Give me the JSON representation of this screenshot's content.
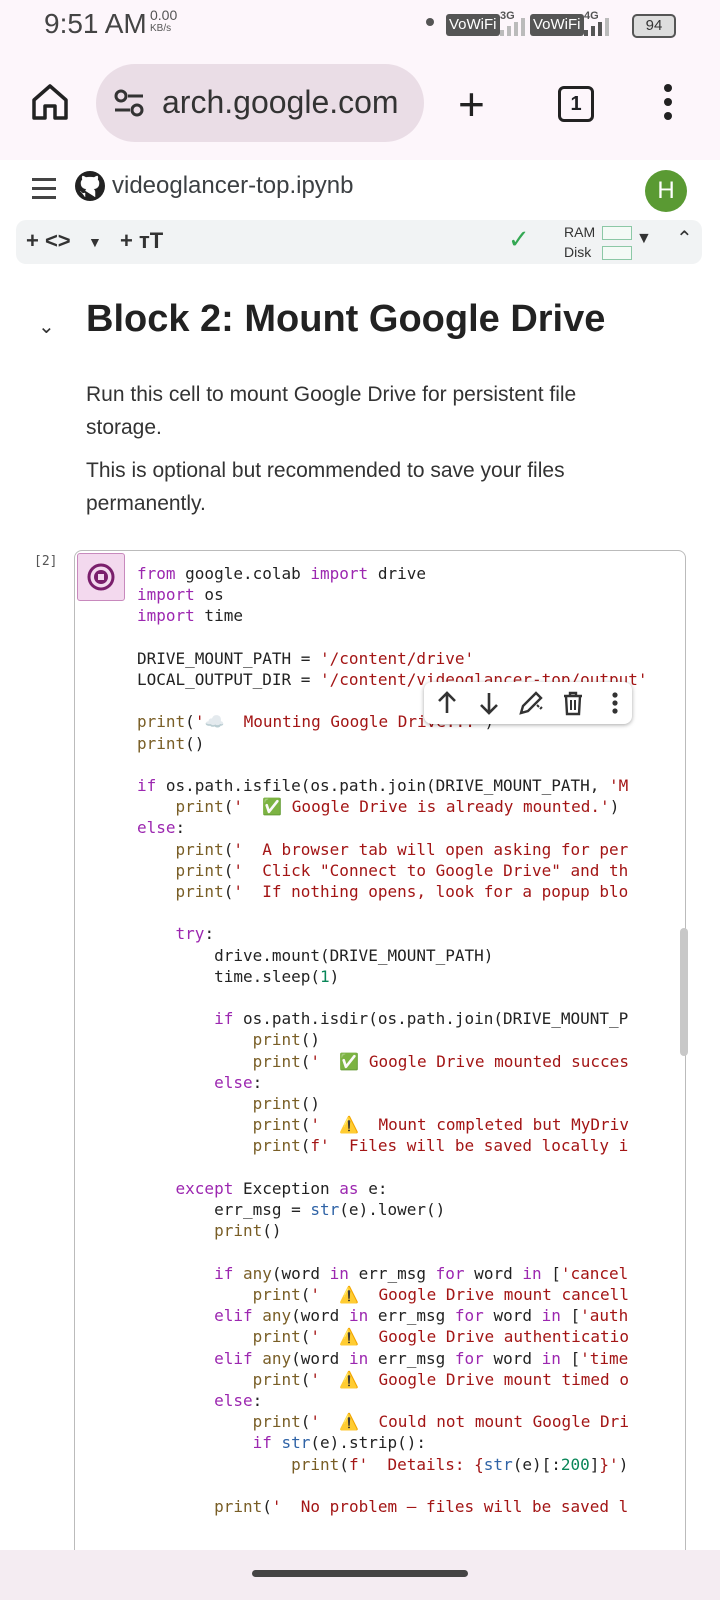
{
  "status_bar": {
    "time": "9:51 AM",
    "speed_value": "0.00",
    "speed_unit": "KB/s",
    "vowifi_1": "VoWiFi",
    "net_1": "3G",
    "vowifi_2": "VoWiFi",
    "net_2": "4G",
    "battery": "94"
  },
  "browser": {
    "url": "arch.google.com",
    "tab_count": "1"
  },
  "notebook": {
    "title": "videoglancer-top.ipynb",
    "avatar_letter": "H",
    "toolbar": {
      "add_code": "+ <>",
      "add_text": "+ тT",
      "ram_label": "RAM",
      "disk_label": "Disk"
    }
  },
  "section": {
    "title": "Block 2: Mount Google Drive",
    "para1": "Run this cell to mount Google Drive for persistent file storage.",
    "para2": "This is optional but recommended to save your files permanently."
  },
  "cell": {
    "execution_count": "[2]"
  }
}
